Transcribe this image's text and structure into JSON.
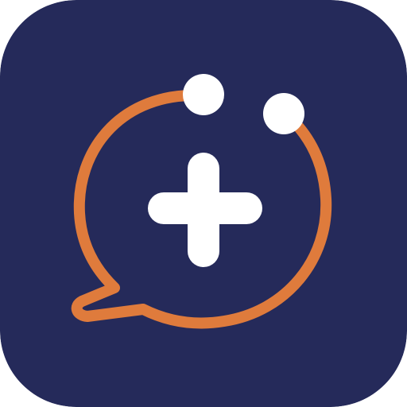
{
  "app_icon": {
    "name": "chat-plus-app-icon",
    "icons": {
      "background": "rounded-square",
      "bubble": "chat-bubble-outline-icon",
      "symbol": "plus-icon",
      "accents": "dot-icon"
    },
    "colors": {
      "background": "#252A5A",
      "bubble_stroke": "#DF7B3C",
      "plus": "#FFFFFF",
      "dots": "#FFFFFF"
    }
  }
}
